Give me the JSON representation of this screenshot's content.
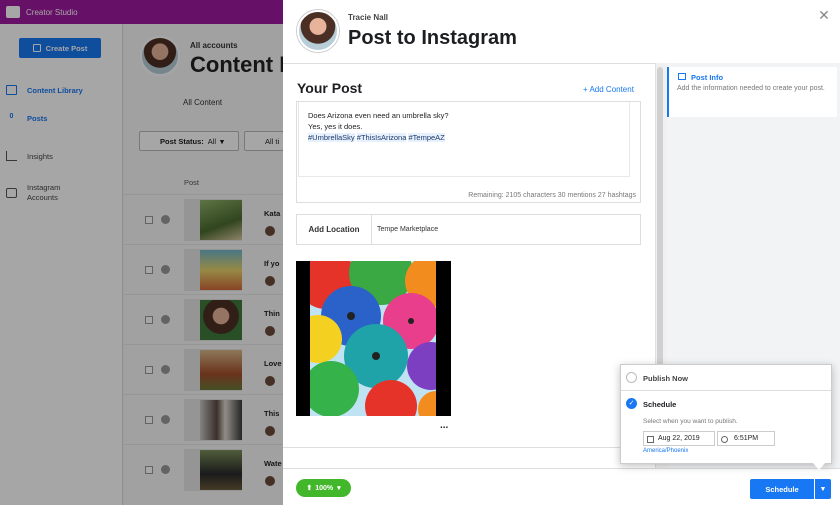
{
  "app": {
    "title": "Creator Studio",
    "create_post": "Create Post",
    "nav": [
      {
        "label": "Content Library",
        "active": true
      },
      {
        "label": "Posts",
        "prefix": "0",
        "active": true
      },
      {
        "label": "Insights"
      },
      {
        "label": "Instagram Accounts"
      }
    ],
    "account_label": "All accounts",
    "page_title": "Content L",
    "tab_all_content": "All Content",
    "filter_status_label": "Post Status:",
    "filter_status_value": "All",
    "filter_more": "All ti",
    "column_post": "Post",
    "rows": [
      "Kata",
      "If yo",
      "Thin",
      "Love",
      "This",
      "Wate"
    ]
  },
  "modal": {
    "username": "Tracie Nall",
    "title": "Post to Instagram",
    "close_icon": "close-icon",
    "your_post": "Your Post",
    "add_content": "+ Add Content",
    "caption_line1": "Does Arizona even need an umbrella sky?",
    "caption_line2": "Yes, yes it does.",
    "hashtags": [
      "#UmbrellaSky",
      "#ThisIsArizona",
      "#TempeAZ"
    ],
    "remaining": "Remaining: 2105 characters 30 mentions 27 hashtags",
    "location_label": "Add Location",
    "location_value": "Tempe Marketplace",
    "more_dots": "...",
    "post_info_title": "Post Info",
    "post_info_desc": "Add the information needed to create your post.",
    "upload_pct": "100%",
    "schedule_button": "Schedule"
  },
  "publish": {
    "publish_now": "Publish Now",
    "schedule": "Schedule",
    "schedule_selected": true,
    "schedule_desc": "Select when you want to publish.",
    "date": "Aug 22, 2019",
    "time": "6:51PM",
    "timezone": "America/Phoenix"
  },
  "colors": {
    "accent": "#1877f2",
    "topbar": "#9e1a9e",
    "success": "#42b72a"
  }
}
